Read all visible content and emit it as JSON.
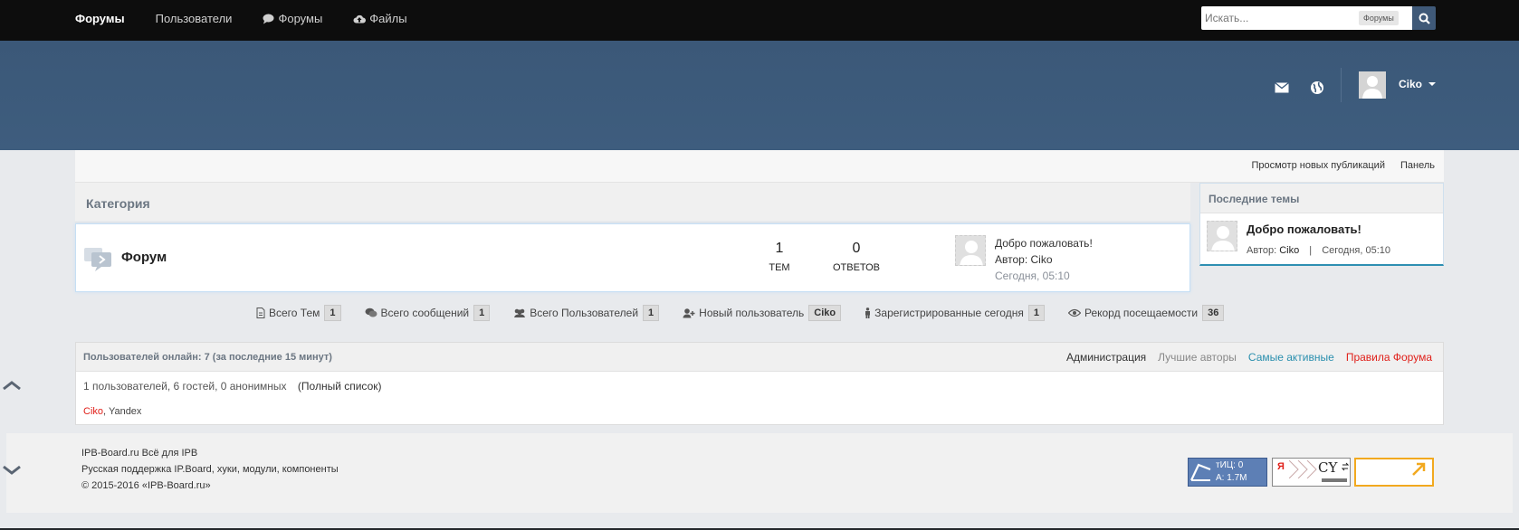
{
  "topnav": {
    "items": [
      {
        "label": "Форумы",
        "active": true
      },
      {
        "label": "Пользователи"
      },
      {
        "label": "Форумы",
        "icon": "comment-icon"
      },
      {
        "label": "Файлы",
        "icon": "cloud-upload-icon"
      }
    ]
  },
  "search": {
    "placeholder": "Искать...",
    "scope": "Форумы"
  },
  "header": {
    "user_name": "Ciko"
  },
  "crumbbar": {
    "new_posts": "Просмотр новых публикаций",
    "panel": "Панель"
  },
  "category": {
    "title": "Категория",
    "forum": {
      "title": "Форум",
      "topics_count": "1",
      "topics_label": "ТЕМ",
      "replies_count": "0",
      "replies_label": "ОТВЕТОВ",
      "last_title": "Добро пожаловать!",
      "last_author": "Автор: Ciko",
      "last_time": "Сегодня, 05:10"
    }
  },
  "recent": {
    "title": "Последние темы",
    "topic_title": "Добро пожаловать!",
    "author_label": "Автор:",
    "author": "Ciko",
    "separator": "|",
    "time": "Сегодня, 05:10"
  },
  "stats": [
    {
      "label": "Всего Тем",
      "value": "1",
      "icon": "file-icon"
    },
    {
      "label": "Всего сообщений",
      "value": "1",
      "icon": "comments-icon"
    },
    {
      "label": "Всего Пользователей",
      "value": "1",
      "icon": "users-icon"
    },
    {
      "label": "Новый пользователь",
      "value": "Ciko",
      "icon": "user-plus-icon"
    },
    {
      "label": "Зарегистрированные сегодня",
      "value": "1",
      "icon": "person-icon"
    },
    {
      "label": "Рекорд посещаемости",
      "value": "36",
      "icon": "eye-icon"
    }
  ],
  "online": {
    "title": "Пользователей онлайн: 7 (за последние 15 минут)",
    "tabs": [
      {
        "label": "Администрация",
        "color": "#333333"
      },
      {
        "label": "Лучшие авторы",
        "color": "#888888"
      },
      {
        "label": "Самые активные",
        "color": "#2a8fae"
      },
      {
        "label": "Правила Форума",
        "color": "#e0201a"
      }
    ],
    "counts": "1 пользователей, 6 гостей, 0 анонимных",
    "full_list": "(Полный список)",
    "user_admin": "Ciko",
    "user_admin_color": "#e0201a",
    "user_sep": ",",
    "user_other": "Yandex"
  },
  "footer": {
    "line1": "IPB-Board.ru Всё для IPB",
    "line2": "Русская поддержка IP.Board, хуки, модули, компоненты",
    "line3": "© 2015-2016 «IPB-Board.ru»"
  },
  "counters": {
    "tic_label": "тИЦ: 0",
    "a_label": "А: 1.7M",
    "ya_label": "Я",
    "cy_label": "CY"
  }
}
